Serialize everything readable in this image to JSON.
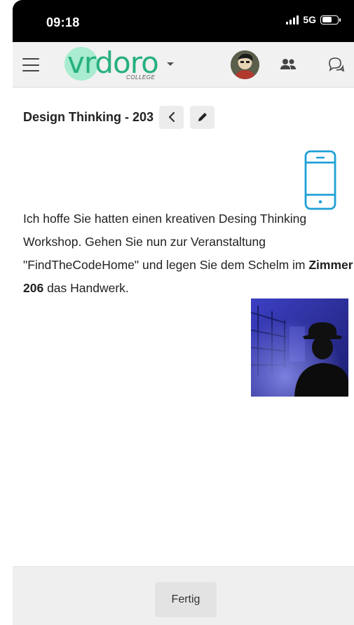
{
  "status_bar": {
    "time": "09:18",
    "network": "5G",
    "battery_level": 0.62
  },
  "header": {
    "logo_text": "vrdoro",
    "logo_subtext": "COLLEGE",
    "icons": [
      "menu-icon",
      "avatar",
      "people-icon",
      "chat-icon"
    ]
  },
  "page": {
    "title": "Design Thinking - 203",
    "back_icon": "chevron-left-icon",
    "edit_icon": "pencil-icon"
  },
  "content": {
    "icon": "smartphone-icon",
    "text_part1": "Ich hoffe Sie hatten einen kreativen Desing Thinking Workshop. Gehen Sie nun zur Veranstaltung \"FindTheCodeHome\" und legen Sie dem Schelm im ",
    "text_bold": "Zimmer 206",
    "text_part2": " das Handwerk."
  },
  "footer": {
    "done_label": "Fertig"
  },
  "colors": {
    "brand_green": "#27b07e",
    "brand_blob": "#a9ecd0",
    "phone_icon": "#1fa0d8",
    "image_blue": "#2b2e9e"
  }
}
